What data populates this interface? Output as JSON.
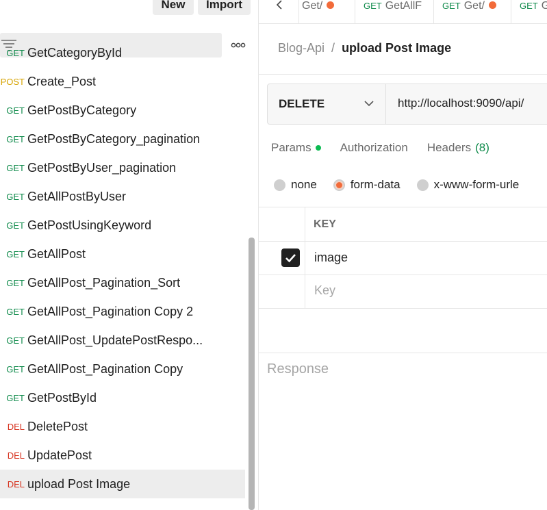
{
  "sidebar": {
    "new_label": "New",
    "import_label": "Import",
    "items": [
      {
        "method": "GET",
        "name": "GetCategoryById"
      },
      {
        "method": "POST",
        "name": "Create_Post"
      },
      {
        "method": "GET",
        "name": "GetPostByCategory"
      },
      {
        "method": "GET",
        "name": "GetPostByCategory_pagination"
      },
      {
        "method": "GET",
        "name": "GetPostByUser_pagination"
      },
      {
        "method": "GET",
        "name": "GetAllPostByUser"
      },
      {
        "method": "GET",
        "name": "GetPostUsingKeyword"
      },
      {
        "method": "GET",
        "name": "GetAllPost"
      },
      {
        "method": "GET",
        "name": "GetAllPost_Pagination_Sort"
      },
      {
        "method": "GET",
        "name": "GetAllPost_Pagination Copy 2"
      },
      {
        "method": "GET",
        "name": "GetAllPost_UpdatePostRespo..."
      },
      {
        "method": "GET",
        "name": "GetAllPost_Pagination Copy"
      },
      {
        "method": "GET",
        "name": "GetPostById"
      },
      {
        "method": "DEL",
        "name": "DeletePost"
      },
      {
        "method": "DEL",
        "name": "UpdatePost"
      },
      {
        "method": "DEL",
        "name": "upload Post Image",
        "selected": true
      }
    ]
  },
  "tabs": [
    {
      "method": "",
      "name": "Get/",
      "dirty": true
    },
    {
      "method": "GET",
      "name": "GetAllF",
      "dirty": false
    },
    {
      "method": "GET",
      "name": "Get/",
      "dirty": true
    },
    {
      "method": "GET",
      "name": "G",
      "dirty": false
    }
  ],
  "breadcrumb": {
    "collection": "Blog-Api",
    "separator": "/",
    "request": "upload Post Image"
  },
  "request": {
    "method": "DELETE",
    "url": "http://localhost:9090/api/"
  },
  "request_tabs": {
    "params": "Params",
    "authorization": "Authorization",
    "headers": "Headers",
    "headers_count": "(8)"
  },
  "body_types": {
    "none": "none",
    "form_data": "form-data",
    "urlencoded": "x-www-form-urle"
  },
  "form_table": {
    "key_header": "KEY",
    "rows": [
      {
        "key": "image",
        "checked": true
      }
    ],
    "key_placeholder": "Key"
  },
  "response": {
    "label": "Response"
  },
  "colors": {
    "get": "#0e8a4a",
    "post": "#d6a300",
    "del": "#d6321e",
    "accent": "#f26b3a",
    "status_green": "#0cbb52"
  }
}
